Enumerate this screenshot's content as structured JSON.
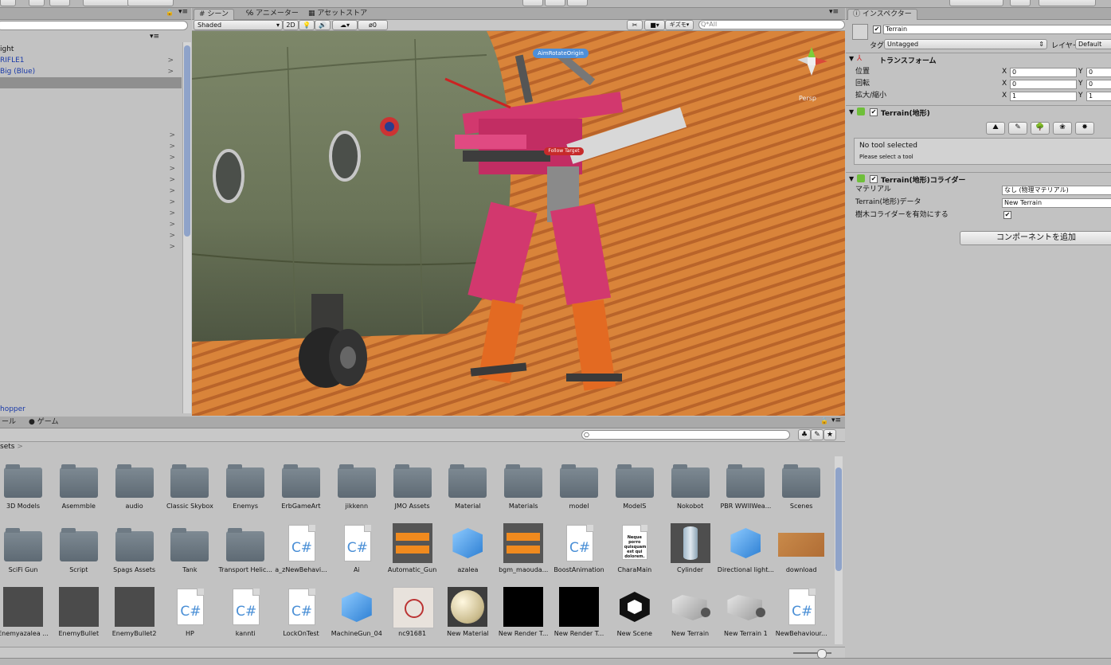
{
  "top_bar": {},
  "hierarchy": {
    "rows": [
      {
        "label": "ight",
        "color": "#111111",
        "selected": false,
        "arrow": false
      },
      {
        "label": "RIFLE1",
        "color": "#1a3aa8",
        "selected": false,
        "arrow": true
      },
      {
        "label": "Big (Blue)",
        "color": "#1a3aa8",
        "selected": false,
        "arrow": true
      },
      {
        "label": "",
        "color": "#111111",
        "selected": true,
        "arrow": false
      }
    ],
    "bottom_label": "hopper",
    "empty_arrow_rows": 11
  },
  "scene": {
    "tabs": [
      {
        "label": "# シーン",
        "active": true
      },
      {
        "label": "℅ アニメーター",
        "active": false
      },
      {
        "label": "▦ アセットストア",
        "active": false
      }
    ],
    "shading_mode": "Shaded",
    "btn_2d": "2D",
    "gizmos_label": "ギズモ",
    "search_placeholder": "Q*All",
    "persp_label": "Persp",
    "labels": {
      "aim": "AimRotateOrigin",
      "follow": "Follow Target"
    },
    "colors": {
      "sand": "#d9843a",
      "mech": "#d2386e",
      "heli": "#6f7a5e"
    }
  },
  "inspector": {
    "tab": "インスペクター",
    "object_name": "Terrain",
    "tag_label": "タグ",
    "tag_value": "Untagged",
    "layer_label": "レイヤー",
    "layer_value": "Default",
    "transform": {
      "title": "トランスフォーム",
      "rows": [
        {
          "label": "位置",
          "x": "0",
          "y": "0"
        },
        {
          "label": "回転",
          "x": "0",
          "y": "0"
        },
        {
          "label": "拡大/縮小",
          "x": "1",
          "y": "1"
        }
      ]
    },
    "terrain": {
      "title": "Terrain(地形)",
      "no_tool": "No tool selected",
      "please_select": "Please select a tool"
    },
    "collider": {
      "title": "Terrain(地形)コライダー",
      "rows": [
        {
          "label": "マテリアル",
          "value": "なし (物理マテリアル)"
        },
        {
          "label": "Terrain(地形)データ",
          "value": "New Terrain"
        }
      ],
      "tree_collider_label": "樹木コライダーを有効にする",
      "tree_collider_checked": true
    },
    "add_component": "コンポーネントを追加"
  },
  "project": {
    "tabs": [
      {
        "label": "ール",
        "active": false
      },
      {
        "label": "● ゲーム",
        "active": false
      }
    ],
    "breadcrumb": "sets",
    "assets": [
      {
        "name": "3D Models",
        "kind": "folder"
      },
      {
        "name": "Asemmble",
        "kind": "folder"
      },
      {
        "name": "audio",
        "kind": "folder"
      },
      {
        "name": "Classic Skybox",
        "kind": "folder"
      },
      {
        "name": "Enemys",
        "kind": "folder"
      },
      {
        "name": "ErbGameArt",
        "kind": "folder"
      },
      {
        "name": "jikkenn",
        "kind": "folder"
      },
      {
        "name": "JMO Assets",
        "kind": "folder"
      },
      {
        "name": "Material",
        "kind": "folder"
      },
      {
        "name": "Materials",
        "kind": "folder"
      },
      {
        "name": "model",
        "kind": "folder"
      },
      {
        "name": "ModelS",
        "kind": "folder"
      },
      {
        "name": "Nokobot",
        "kind": "folder"
      },
      {
        "name": "PBR WWIIWea...",
        "kind": "folder"
      },
      {
        "name": "Scenes",
        "kind": "folder"
      },
      {
        "name": "SciFi Gun",
        "kind": "folder"
      },
      {
        "name": "Script",
        "kind": "folder"
      },
      {
        "name": "Spags Assets",
        "kind": "folder"
      },
      {
        "name": "Tank",
        "kind": "folder"
      },
      {
        "name": "Transport Helic...",
        "kind": "folder"
      },
      {
        "name": "a_zNewBehavi...",
        "kind": "cs"
      },
      {
        "name": "Ai",
        "kind": "cs"
      },
      {
        "name": "Automatic_Gun",
        "kind": "audio"
      },
      {
        "name": "azalea",
        "kind": "cube"
      },
      {
        "name": "bgm_maouda...",
        "kind": "audio"
      },
      {
        "name": "BoostAnimation",
        "kind": "cs"
      },
      {
        "name": "CharaMain",
        "kind": "text"
      },
      {
        "name": "Cylinder",
        "kind": "cylinder"
      },
      {
        "name": "Directional light...",
        "kind": "cube"
      },
      {
        "name": "download",
        "kind": "image"
      },
      {
        "name": "Enemyazalea ...",
        "kind": "dark"
      },
      {
        "name": "EnemyBullet",
        "kind": "dark"
      },
      {
        "name": "EnemyBullet2",
        "kind": "dark"
      },
      {
        "name": "HP",
        "kind": "cs"
      },
      {
        "name": "kannti",
        "kind": "cs"
      },
      {
        "name": "LockOnTest",
        "kind": "cs"
      },
      {
        "name": "MachineGun_04",
        "kind": "cube"
      },
      {
        "name": "nc91681",
        "kind": "target"
      },
      {
        "name": "New Material",
        "kind": "sphere"
      },
      {
        "name": "New Render T...",
        "kind": "black"
      },
      {
        "name": "New Render T...",
        "kind": "black"
      },
      {
        "name": "New Scene",
        "kind": "unity"
      },
      {
        "name": "New Terrain",
        "kind": "terrain"
      },
      {
        "name": "New Terrain 1",
        "kind": "terrain"
      },
      {
        "name": "NewBehaviour...",
        "kind": "cs"
      }
    ],
    "text_preview": "Neque porro quisquam est qui dolorem."
  },
  "status_bar": {}
}
